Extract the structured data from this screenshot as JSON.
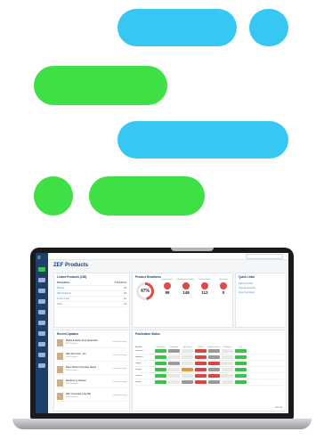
{
  "decor": {
    "pill_blue": "#36c8f2",
    "pill_green": "#3fe046"
  },
  "colors": {
    "sidebar": "#1f3f6b",
    "accent_green": "#3fbf4e",
    "link": "#4c88c9",
    "status_green": "#3fbf4e",
    "status_red": "#d9463f",
    "status_gray": "#9a9a9a",
    "status_orange": "#e79a3a",
    "status_light": "#e8e8e8"
  },
  "app": {
    "breadcrumb": "",
    "page_title": "ZEF Products"
  },
  "sidebar": {
    "items": [
      {
        "icon": "home-icon",
        "active": true
      },
      {
        "icon": "grid-icon",
        "active": false
      },
      {
        "icon": "chart-icon",
        "active": false
      },
      {
        "icon": "list-icon",
        "active": false
      },
      {
        "icon": "tag-icon",
        "active": false
      },
      {
        "icon": "cart-icon",
        "active": false
      },
      {
        "icon": "box-icon",
        "active": false
      },
      {
        "icon": "user-icon",
        "active": false
      },
      {
        "icon": "gear-icon",
        "active": false
      },
      {
        "icon": "bell-icon",
        "active": false
      }
    ]
  },
  "linked_products": {
    "title": "Linked Products (189)",
    "header_left": "Procedures",
    "header_right": "# Products",
    "rows": [
      {
        "name": "Baking",
        "value": "23"
      },
      {
        "name": "ZEF Products",
        "value": "44"
      },
      {
        "name": "Fruits & Veg",
        "value": "12"
      },
      {
        "name": "Dairy",
        "value": "31"
      }
    ]
  },
  "product_readiness": {
    "title": "Product Readiness",
    "score": "47%",
    "score_fraction": 0.47,
    "metrics": [
      {
        "label": "Initial Score",
        "value": "98",
        "color": "#e04848"
      },
      {
        "label": "Required to Publish",
        "value": "148",
        "color": "#e04848"
      },
      {
        "label": "Content Score",
        "value": "112",
        "color": "#e04848"
      },
      {
        "label": "Rejected",
        "value": "0",
        "color": "#e04848"
      }
    ]
  },
  "quick_links": {
    "title": "Quick Links",
    "links": [
      "Add a product",
      "Upload products",
      "Export products"
    ]
  },
  "recent_updates": {
    "title": "Recent Updates",
    "items": [
      {
        "name": "Melba & Butter Fruit Squarefite",
        "sub": "ZEF Products",
        "when": "a few hours ago"
      },
      {
        "name": "ZEF Rice Dish - 4ct",
        "sub": "ZEF Products",
        "when": "a few hours ago"
      },
      {
        "name": "Bean Mixed Chocolate Sweet",
        "sub": "ZEF Products",
        "when": "a few hours ago"
      },
      {
        "name": "Macaroni & Cheese",
        "sub": "ZEF Products",
        "when": "a few hours ago"
      },
      {
        "name": "ZEF Chocolate Chip Bar",
        "sub": "ZEF Products",
        "when": "a few hours ago"
      }
    ]
  },
  "publication_status": {
    "title": "Publication Status",
    "first_header": "Retailer",
    "columns": [
      "Not Started",
      "Submitted",
      "Accepted",
      "Failed",
      "Needs Review",
      "Published",
      "Live"
    ],
    "rows": [
      {
        "retailer": "Amazon",
        "cells": [
          "green",
          "gray",
          "light",
          "red",
          "gray",
          "light",
          "green"
        ]
      },
      {
        "retailer": "Walmart",
        "cells": [
          "green",
          "light",
          "light",
          "red",
          "gray",
          "light",
          "green"
        ]
      },
      {
        "retailer": "Target",
        "cells": [
          "green",
          "gray",
          "light",
          "red",
          "red",
          "light",
          "green"
        ]
      },
      {
        "retailer": "Kroger",
        "cells": [
          "green",
          "light",
          "orange",
          "red",
          "gray",
          "light",
          "green"
        ]
      },
      {
        "retailer": "Costco",
        "cells": [
          "green",
          "light",
          "light",
          "red",
          "red",
          "light",
          "green"
        ]
      },
      {
        "retailer": "Publix",
        "cells": [
          "green",
          "light",
          "gray",
          "red",
          "gray",
          "light",
          "green"
        ]
      }
    ],
    "view_all": "View All"
  }
}
